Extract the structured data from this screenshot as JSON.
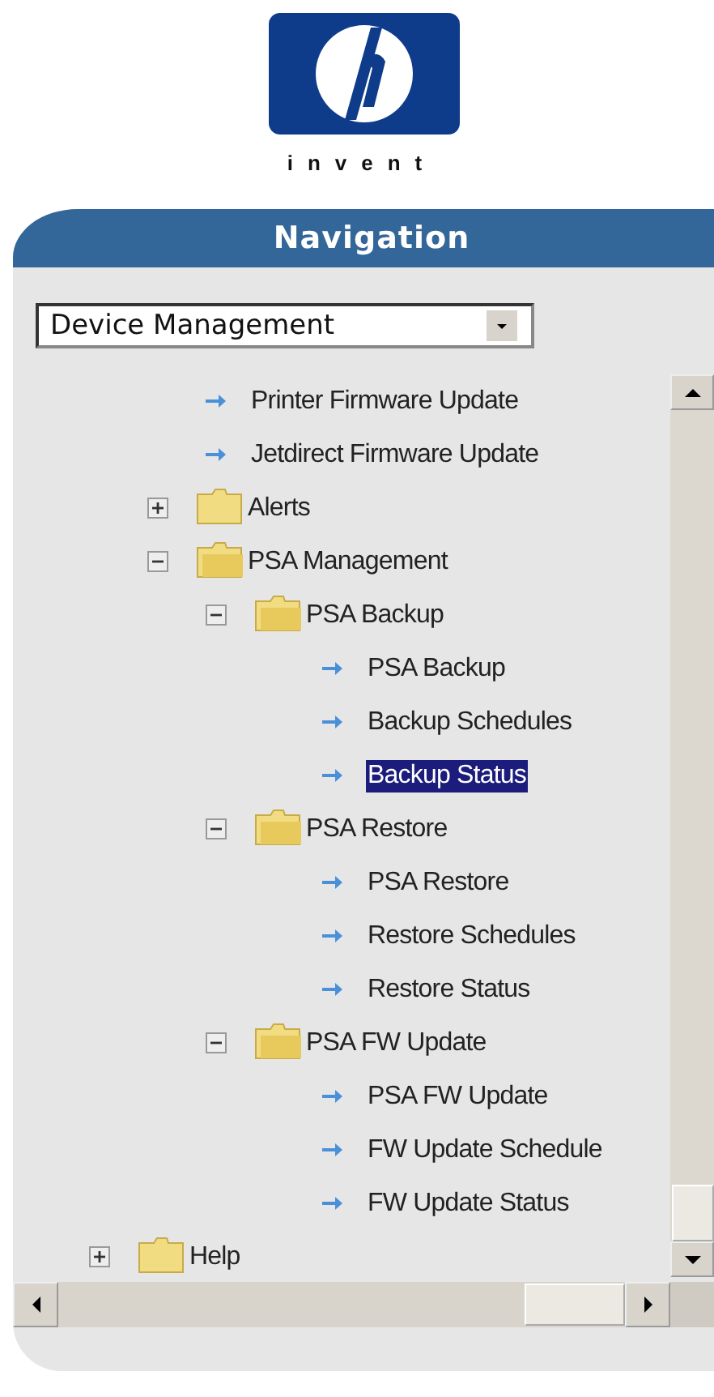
{
  "logo": {
    "tagline": "invent"
  },
  "panel": {
    "title": "Navigation"
  },
  "section_select": {
    "value": "Device Management"
  },
  "tree": {
    "items": [
      {
        "kind": "continued",
        "children": [
          {
            "kind": "leaf",
            "label": "Printer Firmware Update",
            "selected": false
          },
          {
            "kind": "leaf",
            "label": "Jetdirect Firmware Update",
            "selected": false
          },
          {
            "kind": "folder",
            "label": "Alerts",
            "expanded": false
          },
          {
            "kind": "folder",
            "label": "PSA Management",
            "expanded": true,
            "children": [
              {
                "kind": "folder",
                "label": "PSA Backup",
                "expanded": true,
                "children": [
                  {
                    "kind": "leaf",
                    "label": "PSA Backup",
                    "selected": false
                  },
                  {
                    "kind": "leaf",
                    "label": "Backup Schedules",
                    "selected": false
                  },
                  {
                    "kind": "leaf",
                    "label": "Backup Status",
                    "selected": true
                  }
                ]
              },
              {
                "kind": "folder",
                "label": "PSA Restore",
                "expanded": true,
                "children": [
                  {
                    "kind": "leaf",
                    "label": "PSA Restore",
                    "selected": false
                  },
                  {
                    "kind": "leaf",
                    "label": "Restore Schedules",
                    "selected": false
                  },
                  {
                    "kind": "leaf",
                    "label": "Restore Status",
                    "selected": false
                  }
                ]
              },
              {
                "kind": "folder",
                "label": "PSA FW Update",
                "expanded": true,
                "children": [
                  {
                    "kind": "leaf",
                    "label": "PSA FW Update",
                    "selected": false
                  },
                  {
                    "kind": "leaf",
                    "label": "FW Update Schedule",
                    "selected": false
                  },
                  {
                    "kind": "leaf",
                    "label": "FW Update Status",
                    "selected": false
                  }
                ]
              }
            ]
          }
        ]
      },
      {
        "kind": "folder",
        "label": "Help",
        "expanded": false
      }
    ]
  }
}
